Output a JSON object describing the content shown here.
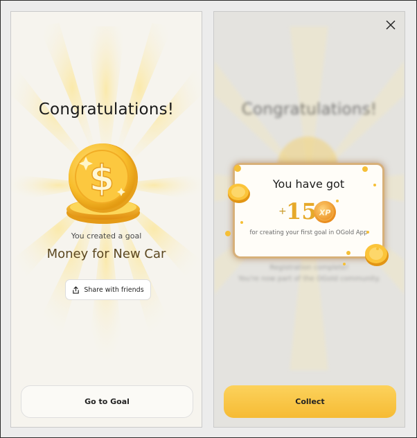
{
  "left_screen": {
    "title": "Congratulations!",
    "goal_caption": "You created a goal",
    "goal_name": "Money for New Car",
    "share_label": "Share with friends",
    "primary_label": "Go to Goal"
  },
  "right_screen": {
    "background_title": "Congratulations!",
    "background_line1": "Registration complete!",
    "background_line2": "You're now part of the OGold community.",
    "reward_title": "You have got",
    "xp_sign": "+",
    "xp_value": "15",
    "xp_badge": "XP",
    "reward_text": "for creating your first goal in OGold App",
    "primary_label": "Collect"
  },
  "icons": {
    "coin": "dollar-coin-icon",
    "share": "share-icon",
    "close": "close-icon",
    "xp": "xp-coin-icon"
  },
  "colors": {
    "gold": "#f6bb34",
    "goal_text": "#5b4720",
    "button_yellow": "#fcd25c"
  }
}
